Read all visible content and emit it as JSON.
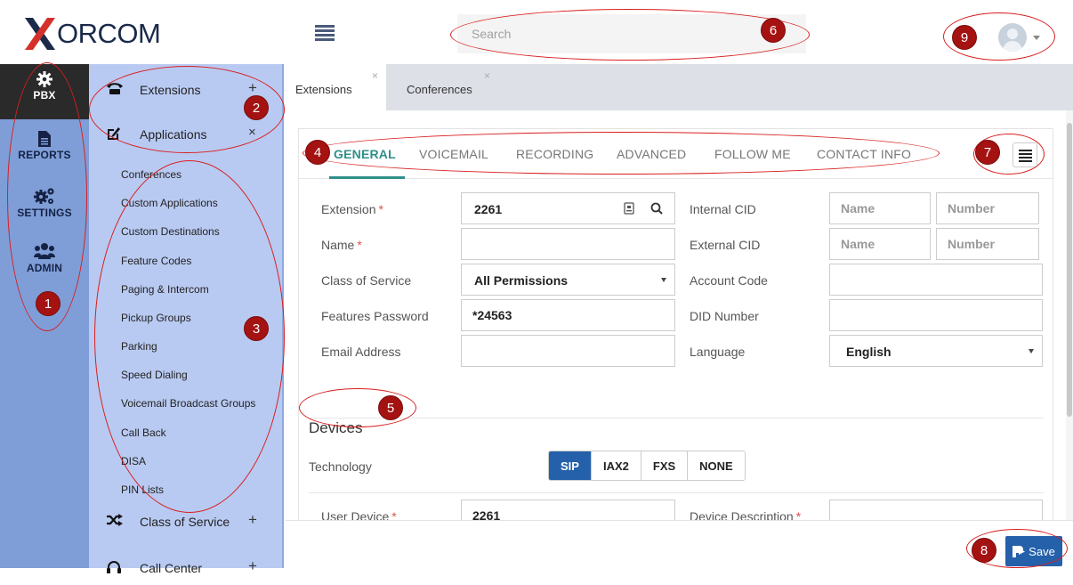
{
  "brand": {
    "logo_text": "ORCOM",
    "logo_letter": "X"
  },
  "header": {
    "search_placeholder": "Search"
  },
  "rail": {
    "items": [
      {
        "label": "PBX",
        "icon": "gear-icon",
        "active": true
      },
      {
        "label": "REPORTS",
        "icon": "document-icon"
      },
      {
        "label": "SETTINGS",
        "icon": "gears-icon"
      },
      {
        "label": "ADMIN",
        "icon": "users-icon"
      }
    ]
  },
  "subnav": {
    "groups": [
      {
        "label": "Extensions",
        "toggle": "+",
        "icon": "phone-icon"
      },
      {
        "label": "Applications",
        "toggle": "×",
        "icon": "edit-icon"
      },
      {
        "label": "Class of Service",
        "toggle": "+",
        "icon": "shuffle-icon"
      },
      {
        "label": "Call Center",
        "toggle": "+",
        "icon": "headset-icon"
      }
    ],
    "applications": [
      "Conferences",
      "Custom Applications",
      "Custom Destinations",
      "Feature Codes",
      "Paging & Intercom",
      "Pickup Groups",
      "Parking",
      "Speed Dialing",
      "Voicemail Broadcast Groups",
      "Call Back",
      "DISA",
      "PIN Lists"
    ]
  },
  "tabs": [
    {
      "label": "Extensions",
      "close": "×",
      "active": true
    },
    {
      "label": "Conferences",
      "close": "×"
    }
  ],
  "subtabs": [
    "GENERAL",
    "VOICEMAIL",
    "RECORDING",
    "ADVANCED",
    "FOLLOW ME",
    "CONTACT INFO"
  ],
  "form": {
    "extension": {
      "label": "Extension",
      "value": "2261",
      "required": "*"
    },
    "name": {
      "label": "Name",
      "value": "",
      "required": "*"
    },
    "class_of_service": {
      "label": "Class of Service",
      "value": "All Permissions"
    },
    "features_password": {
      "label": "Features Password",
      "value": "*24563"
    },
    "email": {
      "label": "Email Address",
      "value": ""
    },
    "internal_cid": {
      "label": "Internal CID",
      "name_placeholder": "Name",
      "number_placeholder": "Number"
    },
    "external_cid": {
      "label": "External CID",
      "name_placeholder": "Name",
      "number_placeholder": "Number"
    },
    "account_code": {
      "label": "Account Code",
      "value": ""
    },
    "did_number": {
      "label": "DID Number",
      "value": ""
    },
    "language": {
      "label": "Language",
      "value": "English"
    }
  },
  "devices": {
    "title": "Devices",
    "technology_label": "Technology",
    "technologies": [
      "SIP",
      "IAX2",
      "FXS",
      "NONE"
    ],
    "selected_technology": "SIP",
    "user_device": {
      "label": "User Device",
      "value": "2261",
      "required": "*"
    },
    "device_description": {
      "label": "Device Description",
      "value": "",
      "required": "*"
    }
  },
  "footer": {
    "save_label": "Save"
  },
  "annotations": [
    "1",
    "2",
    "3",
    "4",
    "5",
    "6",
    "7",
    "8",
    "9"
  ],
  "colors": {
    "rail": "#7f9ed8",
    "subnav": "#b9caf2",
    "accent": "#2f8f89",
    "primary": "#2461aa",
    "annotation": "#d91e1e"
  }
}
